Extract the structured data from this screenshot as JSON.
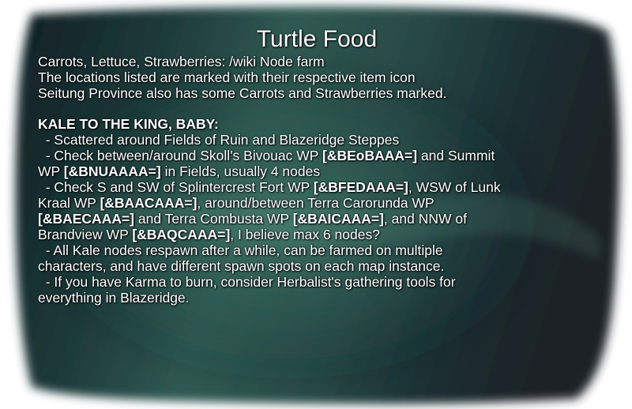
{
  "title": "Turtle Food",
  "intro": [
    "Carrots, Lettuce, Strawberries: /wiki Node farm",
    "The locations listed are marked with their respective item icon",
    "Seitung Province also has some Carrots and Strawberries marked."
  ],
  "kale": {
    "heading": "KALE TO THE KING, BABY:",
    "bullet1": "  - Scattered around Fields of Ruin and Blazeridge Steppes",
    "b2_t1": "  - Check between/around Skoll's Bivouac WP ",
    "b2_code1": "[&BEoBAAA=]",
    "b2_t2": " and Summit",
    "b2_t3": "WP ",
    "b2_code2": "[&BNUAAAA=]",
    "b2_t4": " in Fields, usually 4 nodes",
    "b3_t1": "  - Check S and SW of Splintercrest Fort WP ",
    "b3_code1": "[&BFEDAAA=]",
    "b3_t2": ", WSW of Lunk",
    "b3_t3": "Kraal WP ",
    "b3_code2": "[&BAACAAA=]",
    "b3_t4": ", around/between Terra Carorunda WP",
    "b3_code3": "[&BAECAAA=]",
    "b3_t5": " and Terra Combusta WP ",
    "b3_code4": "[&BAICAAA=]",
    "b3_t6": ", and NNW of",
    "b3_t7": "Brandview WP ",
    "b3_code5": "[&BAQCAAA=]",
    "b3_t8": ", I believe max 6 nodes?",
    "b4_l1": "  - All Kale nodes respawn after a while, can be farmed on multiple",
    "b4_l2": "characters, and have different spawn spots on each map instance.",
    "b5_l1": "  - If you have Karma to burn, consider Herbalist's gathering tools for",
    "b5_l2": "everything in Blazeridge."
  }
}
